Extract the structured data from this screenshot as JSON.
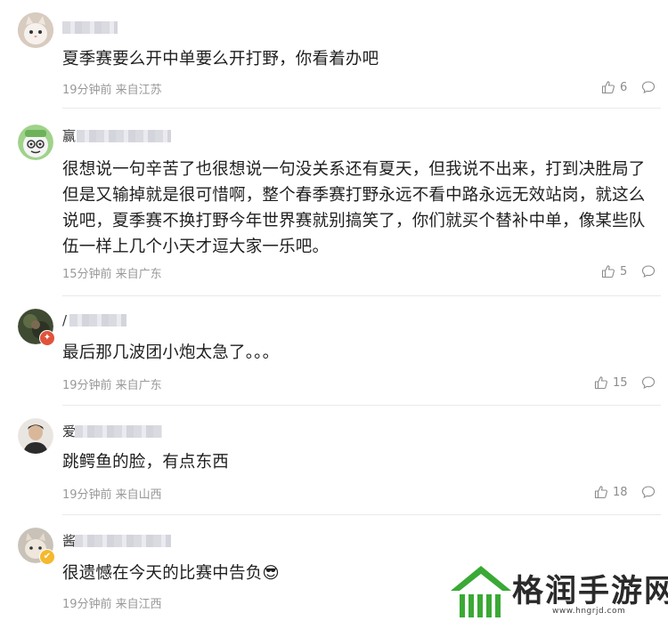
{
  "comments": [
    {
      "name_char": "",
      "text": "夏季赛要么开中单要么开打野，你看着办吧",
      "meta": "19分钟前 来自江苏",
      "likes": "6"
    },
    {
      "name_char": "赢",
      "text": "很想说一句辛苦了也很想说一句没关系还有夏天，但我说不出来，打到决胜局了但是又输掉就是很可惜啊，整个春季赛打野永远不看中路永远无效站岗，就这么说吧，夏季赛不换打野今年世界赛就别搞笑了，你们就买个替补中单，像某些队伍一样上几个小天才逗大家一乐吧。",
      "meta": "15分钟前 来自广东",
      "likes": "5"
    },
    {
      "name_char": "/",
      "text": "最后那几波团小炮太急了。。。",
      "meta": "19分钟前 来自广东",
      "likes": "15"
    },
    {
      "name_char": "爱",
      "text": "跳鳄鱼的脸，有点东西",
      "meta": "19分钟前 来自山西",
      "likes": "18"
    },
    {
      "name_char": "酱",
      "text": "很遗憾在今天的比赛中告负😎",
      "meta": "19分钟前 来自江西",
      "likes": ""
    }
  ],
  "avatar_badges": {
    "third": "fire-badge",
    "fifth": "verified-badge"
  },
  "watermark": {
    "title": "格润手游网",
    "url": "www.hngrjd.com"
  },
  "colors": {
    "meta": "#999999",
    "watermark_green": "#3aa935"
  }
}
